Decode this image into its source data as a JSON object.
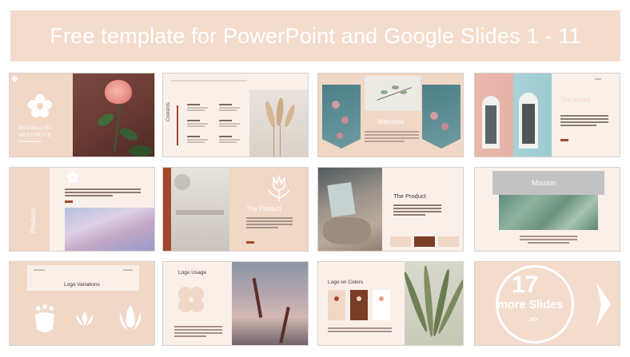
{
  "banner": {
    "title": "Free template for PowerPoint and Google Slides 1 - 11"
  },
  "slides": {
    "s1": {
      "title_line1": "MINIMALIST",
      "title_line2": "AESTHETIC"
    },
    "s2": {
      "title": "Contents"
    },
    "s3": {
      "title": "Welcome"
    },
    "s4": {
      "title": "The Brand"
    },
    "s5": {
      "title": "Products"
    },
    "s6": {
      "title": "The Product"
    },
    "s7": {
      "title": "The Product"
    },
    "s8": {
      "title": "Mission"
    },
    "s9": {
      "title": "Logo Variations"
    },
    "s10": {
      "title": "Logo Usage"
    },
    "s11": {
      "title": "Logo on Colors"
    },
    "s12": {
      "number": "17",
      "label": "more Slides",
      "arrows": ">>"
    }
  },
  "colors": {
    "banner": "#f4dccd",
    "accent": "#a14b2c",
    "slide_bg": "#faf0ea"
  }
}
